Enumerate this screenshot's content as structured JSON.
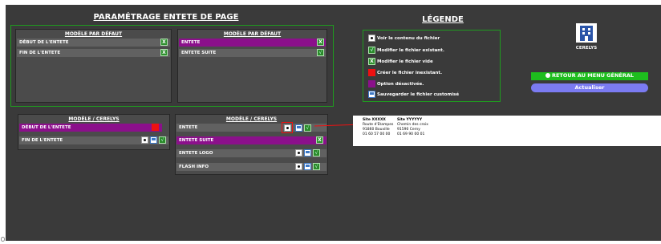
{
  "titles": {
    "main": "PARAMÉTRAGE ENTETE DE PAGE",
    "legend": "LÉGENDE"
  },
  "panels": {
    "default_left": {
      "title": "MODÈLE PAR DÉFAUT",
      "rows": [
        "DÉBUT DE L'ENTETE",
        "FIN DE L'ENTETE"
      ]
    },
    "default_right": {
      "title": "MODÈLE PAR DÉFAUT",
      "rows": [
        "ENTETE",
        "ENTETE SUITE"
      ]
    },
    "cerelys_left": {
      "title": "MODÈLE / CERELYS",
      "rows": [
        "DÉBUT DE L'ENTETE",
        "FIN DE L'ENTETE"
      ]
    },
    "cerelys_right": {
      "title": "MODÈLE / CERELYS",
      "rows": [
        "ENTETE",
        "ENTETE SUITE",
        "ENTETE LOGO",
        "FLASH INFO"
      ]
    }
  },
  "legend": {
    "items": [
      "Voir le contenu du fichier",
      "Modifier le fichier existant.",
      "Modifier le fichier vide",
      "Créer le fichier inexistant.",
      "Option désactivée.",
      "Sauvegarder le fichier customisé"
    ]
  },
  "logo": {
    "label": "CERELYS"
  },
  "buttons": {
    "back": "RETOUR AU MENU GÉNÉRAL",
    "refresh": "Actualiser"
  },
  "preview": {
    "site1": {
      "title": "Site XXXXX",
      "address": "Route d'Etampes",
      "city": "91860 Bouville",
      "phone": "01 60 57 00 00"
    },
    "site2": {
      "title": "Site YYYYYY",
      "address": "Chemin des croix",
      "city": "91590 Cerny",
      "phone": "01 69 90 00 01"
    }
  },
  "colors": {
    "background": "#3a3a3a",
    "purple": "#8b108b",
    "green_border": "#1f9c1f",
    "red": "#ee1111",
    "button_green": "#1ebd1e",
    "button_blue": "#7b7bf2"
  },
  "icons": [
    "view-icon",
    "check-icon",
    "x-icon",
    "save-icon",
    "building-icon"
  ]
}
